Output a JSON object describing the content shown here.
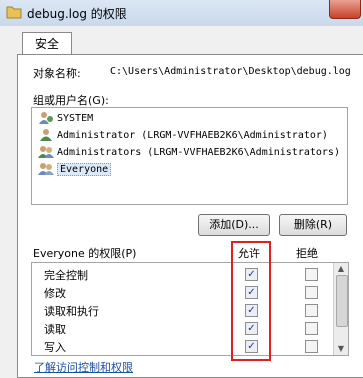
{
  "window": {
    "title": "debug.log 的权限"
  },
  "tabs": [
    {
      "label": "安全"
    }
  ],
  "object": {
    "label": "对象名称:",
    "value": "C:\\Users\\Administrator\\Desktop\\debug.log"
  },
  "groups": {
    "label": "组或用户名(G):",
    "items": [
      {
        "name": "SYSTEM"
      },
      {
        "name": "Administrator (LRGM-VVFHAEB2K6\\Administrator)"
      },
      {
        "name": "Administrators (LRGM-VVFHAEB2K6\\Administrators)"
      },
      {
        "name": "Everyone",
        "selected": true
      }
    ]
  },
  "buttons": {
    "add": "添加(D)...",
    "remove": "删除(R)"
  },
  "permissions": {
    "label": "Everyone 的权限(P)",
    "allow_header": "允许",
    "deny_header": "拒绝",
    "rows": [
      {
        "name": "完全控制",
        "allow": true,
        "deny": false
      },
      {
        "name": "修改",
        "allow": true,
        "deny": false
      },
      {
        "name": "读取和执行",
        "allow": true,
        "deny": false
      },
      {
        "name": "读取",
        "allow": true,
        "deny": false
      },
      {
        "name": "写入",
        "allow": true,
        "deny": false
      }
    ]
  },
  "footer": {
    "link": "了解访问控制和权限"
  }
}
